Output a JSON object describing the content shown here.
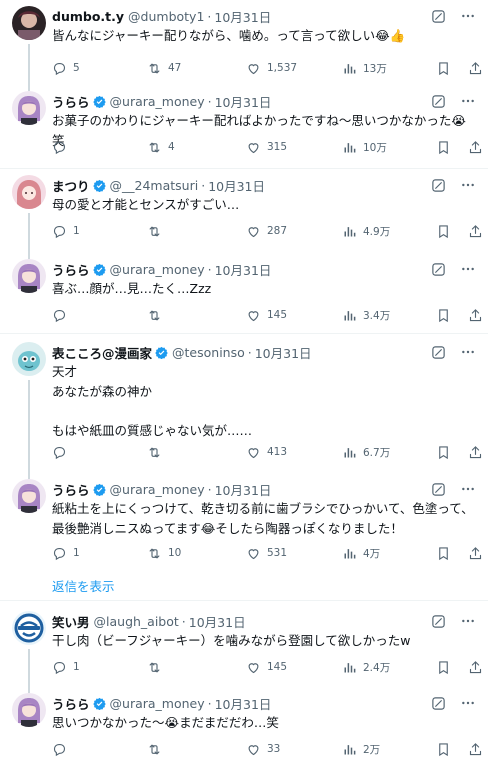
{
  "tweets": [
    {
      "name": "dumbo.t.y",
      "handle": "@dumboty1",
      "date": "10月31日",
      "verified": false,
      "text": "皆んなにジャーキー配りながら、噛め。って言って欲しい😂👍",
      "replies": "5",
      "retweets": "47",
      "likes": "1,537",
      "views": "13万"
    },
    {
      "name": "うらら",
      "handle": "@urara_money",
      "date": "10月31日",
      "verified": true,
      "text": "お菓子のかわりにジャーキー配ればよかったですね〜思いつかなかった😭笑",
      "replies": "",
      "retweets": "4",
      "likes": "315",
      "views": "10万"
    },
    {
      "name": "まつり",
      "handle": "@__24matsuri",
      "date": "10月31日",
      "verified": true,
      "text": "母の愛と才能とセンスがすごい…",
      "replies": "1",
      "retweets": "",
      "likes": "287",
      "views": "4.9万"
    },
    {
      "name": "うらら",
      "handle": "@urara_money",
      "date": "10月31日",
      "verified": true,
      "text": "喜ぶ…顔が…見…たく…Zzz",
      "replies": "",
      "retweets": "",
      "likes": "145",
      "views": "3.4万"
    },
    {
      "name": "表こころ@漫画家",
      "handle": "@tesoninso",
      "date": "10月31日",
      "verified": true,
      "text": "天才\nあなたが森の神か\n\nもはや紙皿の質感じゃない気が……",
      "replies": "",
      "retweets": "",
      "likes": "413",
      "views": "6.7万"
    },
    {
      "name": "うらら",
      "handle": "@urara_money",
      "date": "10月31日",
      "verified": true,
      "text": "紙粘土を上にくっつけて、乾き切る前に歯ブラシでひっかいて、色塗って、\n最後艶消しニスぬってます😂そしたら陶器っぽくなりました！",
      "replies": "1",
      "retweets": "10",
      "likes": "531",
      "views": "4万"
    },
    {
      "name": "笑い男",
      "handle": "@laugh_aibot",
      "date": "10月31日",
      "verified": false,
      "text": "干し肉（ビーフジャーキー）を噛みながら登園して欲しかったw",
      "replies": "1",
      "retweets": "",
      "likes": "145",
      "views": "2.4万"
    },
    {
      "name": "うらら",
      "handle": "@urara_money",
      "date": "10月31日",
      "verified": true,
      "text": "思いつかなかった〜😭まだまだだわ…笑",
      "replies": "",
      "retweets": "",
      "likes": "33",
      "views": "2万"
    }
  ],
  "show_replies_label": "返信を表示",
  "colors": {
    "verified": "#1d9bf0",
    "link": "#1d9bf0",
    "muted": "#536471",
    "thread_line": "#cfd9de"
  },
  "icons": [
    "reply-icon",
    "retweet-icon",
    "like-icon",
    "views-icon",
    "bookmark-icon",
    "share-icon",
    "grok-icon",
    "more-icon",
    "verified-badge-icon"
  ]
}
